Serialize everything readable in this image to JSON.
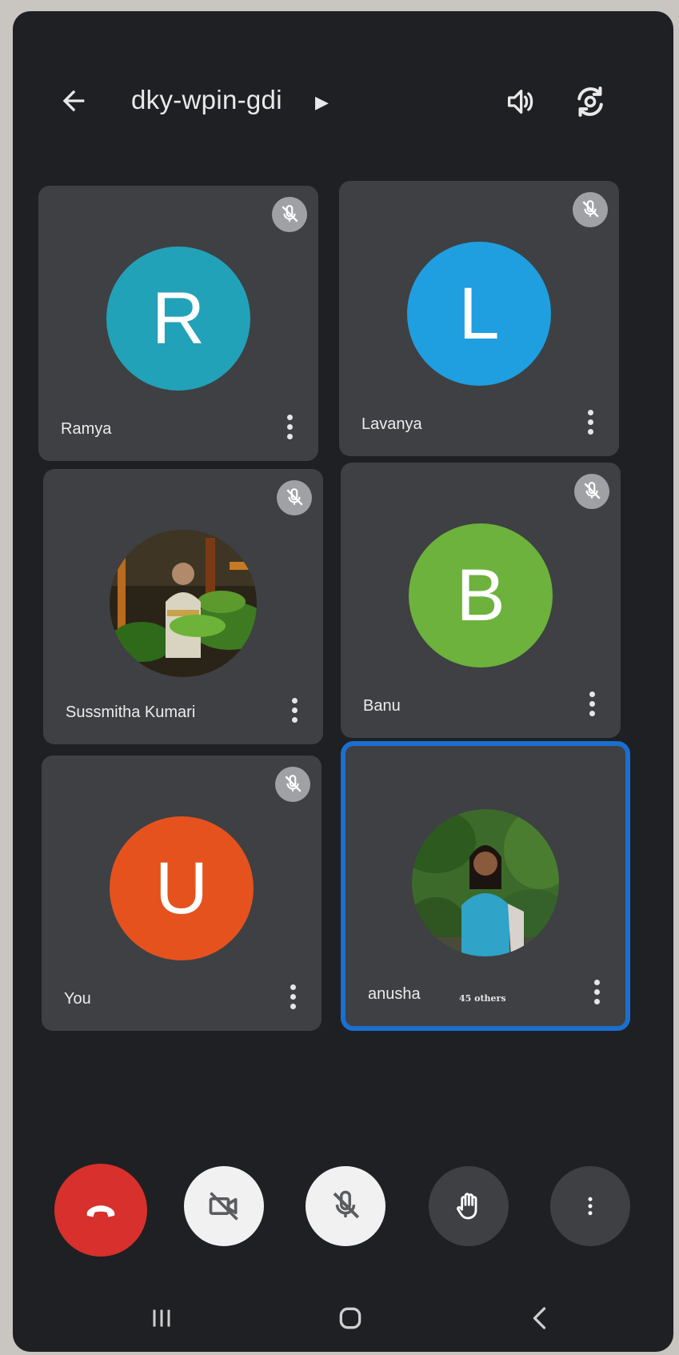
{
  "meeting": {
    "code": "dky-wpin-gdi"
  },
  "colors": {
    "end_call": "#d8302c",
    "active_speaker_border": "#1a6fd0",
    "tile_bg": "#3e4043"
  },
  "participants": [
    {
      "name": "Ramya",
      "initial": "R",
      "avatar_color": "#22a2b8",
      "muted": true
    },
    {
      "name": "Lavanya",
      "initial": "L",
      "avatar_color": "#1f9fe0",
      "muted": true
    },
    {
      "name": "Sussmitha Kumari",
      "initial": "",
      "photo": true,
      "muted": true
    },
    {
      "name": "Banu",
      "initial": "B",
      "avatar_color": "#6cb23c",
      "muted": true
    },
    {
      "name": "You",
      "initial": "U",
      "avatar_color": "#e5521e",
      "muted": true
    },
    {
      "name": "anusha",
      "photo": true,
      "extra": "45 others",
      "active_speaker": true
    }
  ],
  "controls": [
    "end-call",
    "camera-off",
    "mic-off",
    "raise-hand",
    "more-options"
  ],
  "icons": {
    "back": "arrow-left-icon",
    "speaker": "speaker-icon",
    "switch_camera": "switch-camera-icon",
    "muted": "mic-off-icon"
  }
}
